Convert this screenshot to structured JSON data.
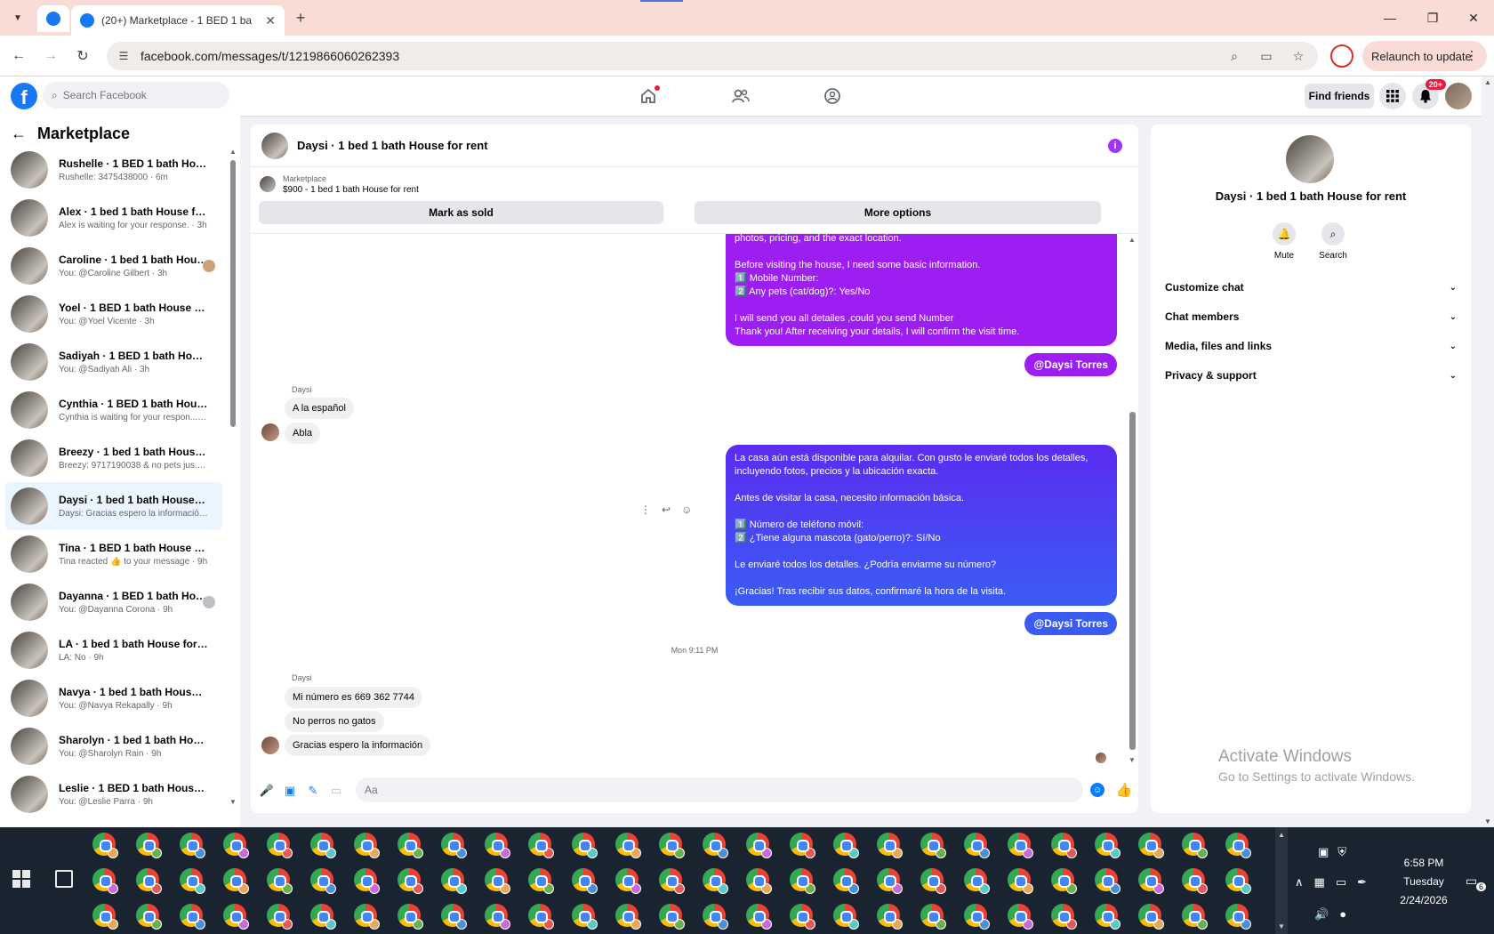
{
  "browser": {
    "tab_title": "(20+) Marketplace - 1 BED 1 ba",
    "url": "facebook.com/messages/t/1219866060262393",
    "relaunch_label": "Relaunch to update"
  },
  "fb": {
    "search_placeholder": "Search Facebook",
    "find_friends": "Find friends",
    "notif_badge": "20+"
  },
  "left_panel": {
    "title": "Marketplace",
    "conversations": [
      {
        "name": "Rushelle · 1 BED 1 bath House f...",
        "sub": "Rushelle: 3475438000 · 6m"
      },
      {
        "name": "Alex · 1 bed 1 bath House for rent",
        "sub": "Alex is waiting for your response. · 3h"
      },
      {
        "name": "Caroline · 1 bed 1 bath House...",
        "sub": "You: @Caroline Gilbert · 3h"
      },
      {
        "name": "Yoel · 1 BED 1 bath House for Re...",
        "sub": "You: @Yoel Vicente · 3h"
      },
      {
        "name": "Sadiyah · 1 BED 1 bath House fo...",
        "sub": "You: @Sadiyah Ali · 3h"
      },
      {
        "name": "Cynthia · 1 BED 1 bath House fo...",
        "sub": "Cynthia is waiting for your respon... · 6h"
      },
      {
        "name": "Breezy · 1 bed 1 bath House for ...",
        "sub": "Breezy: 9717190038 & no pets jus... · 7h"
      },
      {
        "name": "Daysi · 1 bed 1 bath House for r...",
        "sub": "Daysi: Gracias espero la información · 8h"
      },
      {
        "name": "Tina · 1 BED 1 bath House for Re...",
        "sub": "Tina reacted 👍 to your message · 9h"
      },
      {
        "name": "Dayanna · 1 BED 1 bath Hous...",
        "sub": "You: @Dayanna Corona · 9h"
      },
      {
        "name": "LA · 1 bed 1 bath House for rent",
        "sub": "LA: No · 9h"
      },
      {
        "name": "Navya · 1 bed 1 bath House for ...",
        "sub": "You: @Navya Rekapally · 9h"
      },
      {
        "name": "Sharolyn · 1 bed 1 bath House f...",
        "sub": "You: @Sharolyn Rain · 9h"
      },
      {
        "name": "Leslie · 1 BED 1 bath House for ...",
        "sub": "You: @Leslie Parra · 9h"
      }
    ]
  },
  "chat": {
    "title": "Daysi · 1 bed 1 bath House for rent",
    "market_label": "Marketplace",
    "market_listing": "$900 - 1 bed 1 bath House for rent",
    "mark_sold": "Mark as sold",
    "more_options": "More options",
    "msg1_lines": [
      "photos, pricing, and the exact location.",
      "",
      "Before visiting the house, I need some basic information.",
      "1️⃣ Mobile Number:",
      "2️⃣ Any pets (cat/dog)?: Yes/No",
      "",
      "I will send you all detailes ,could you send Number",
      "Thank you! After receiving your details, I will confirm the visit time."
    ],
    "mention": "@Daysi Torres",
    "sender": "Daysi",
    "in1": [
      "A la español",
      "Abla"
    ],
    "msg2_lines": [
      "La casa aún está disponible para alquilar. Con gusto le enviaré todos los detalles,",
      "incluyendo fotos, precios y la ubicación exacta.",
      "",
      "Antes de visitar la casa, necesito información básica.",
      "",
      "1️⃣ Número de teléfono móvil:",
      "2️⃣ ¿Tiene alguna mascota (gato/perro)?: Sí/No",
      "",
      "Le enviaré todos los detalles. ¿Podría enviarme su número?",
      "",
      "¡Gracias! Tras recibir sus datos, confirmaré la hora de la visita."
    ],
    "timestamp": "Mon 9:11 PM",
    "in2": [
      "Mi número es 669 362 7744",
      "No perros no gatos",
      "Gracias espero la información"
    ],
    "composer_placeholder": "Aa"
  },
  "right_panel": {
    "title": "Daysi · 1 bed 1 bath House for rent",
    "mute": "Mute",
    "search": "Search",
    "sections": [
      "Customize chat",
      "Chat members",
      "Media, files and links",
      "Privacy & support"
    ]
  },
  "watermark": {
    "line1": "Activate Windows",
    "line2": "Go to Settings to activate Windows."
  },
  "taskbar": {
    "time": "6:58 PM",
    "day": "Tuesday",
    "date": "2/24/2026",
    "notif_count": "6"
  }
}
